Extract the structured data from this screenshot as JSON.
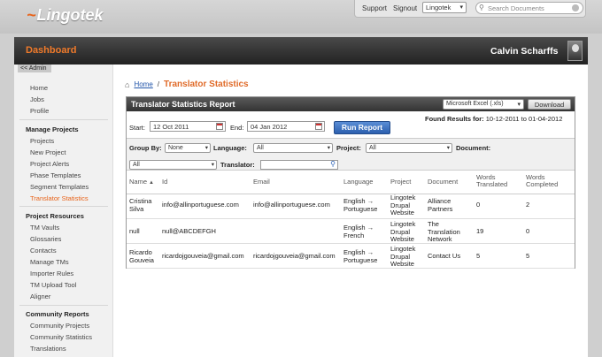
{
  "header": {
    "logo_text": "Lingotek",
    "links": {
      "support": "Support",
      "signout": "Signout"
    },
    "account_select": "Lingotek",
    "search_placeholder": "Search Documents"
  },
  "titlebar": {
    "dashboard": "Dashboard",
    "user_name": "Calvin Scharffs"
  },
  "sidebar": {
    "admin_link": "<< Admin",
    "top_items": [
      "Home",
      "Jobs",
      "Profile"
    ],
    "sections": [
      {
        "title": "Manage Projects",
        "items": [
          "Projects",
          "New Project",
          "Project Alerts",
          "Phase Templates",
          "Segment Templates",
          "Translator Statistics"
        ]
      },
      {
        "title": "Project Resources",
        "items": [
          "TM Vaults",
          "Glossaries",
          "Contacts",
          "Manage TMs",
          "Importer Rules",
          "TM Upload Tool",
          "Aligner"
        ]
      },
      {
        "title": "Community Reports",
        "items": [
          "Community Projects",
          "Community Statistics",
          "Translations"
        ]
      }
    ]
  },
  "breadcrumb": {
    "home": "Home",
    "separator": "/",
    "current": "Translator Statistics"
  },
  "report": {
    "title": "Translator Statistics Report",
    "format_select": "Microsoft Excel (.xls)",
    "download_label": "Download",
    "start_label": "Start:",
    "start_value": "12 Oct 2011",
    "end_label": "End:",
    "end_value": "04 Jan 2012",
    "run_label": "Run Report",
    "found_label": "Found Results for:",
    "found_range": "10-12-2011 to 01-04-2012",
    "filters": {
      "group_by_label": "Group By:",
      "group_by_value": "None",
      "language_label": "Language:",
      "language_value": "All",
      "project_label": "Project:",
      "project_value": "All",
      "document_label": "Document:",
      "document_value": "All",
      "translator_label": "Translator:",
      "translator_value": ""
    },
    "columns": [
      "Name",
      "Id",
      "Email",
      "Language",
      "Project",
      "Document",
      "Words Translated",
      "Words Completed"
    ],
    "rows": [
      {
        "name": "Cristina Silva",
        "id": "info@allinportuguese.com",
        "email": "info@allinportuguese.com",
        "language": "English → Portuguese",
        "project": "Lingotek Drupal Website",
        "document": "Alliance Partners",
        "translated": "0",
        "completed": "2"
      },
      {
        "name": "null",
        "id": "null@ABCDEFGH",
        "email": "",
        "language": "English → French",
        "project": "Lingotek Drupal Website",
        "document": "The Translation Network",
        "translated": "19",
        "completed": "0"
      },
      {
        "name": "Ricardo Gouveia",
        "id": "ricardojgouveia@gmail.com",
        "email": "ricardojgouveia@gmail.com",
        "language": "English → Portuguese",
        "project": "Lingotek Drupal Website",
        "document": "Contact Us",
        "translated": "5",
        "completed": "5"
      }
    ]
  }
}
